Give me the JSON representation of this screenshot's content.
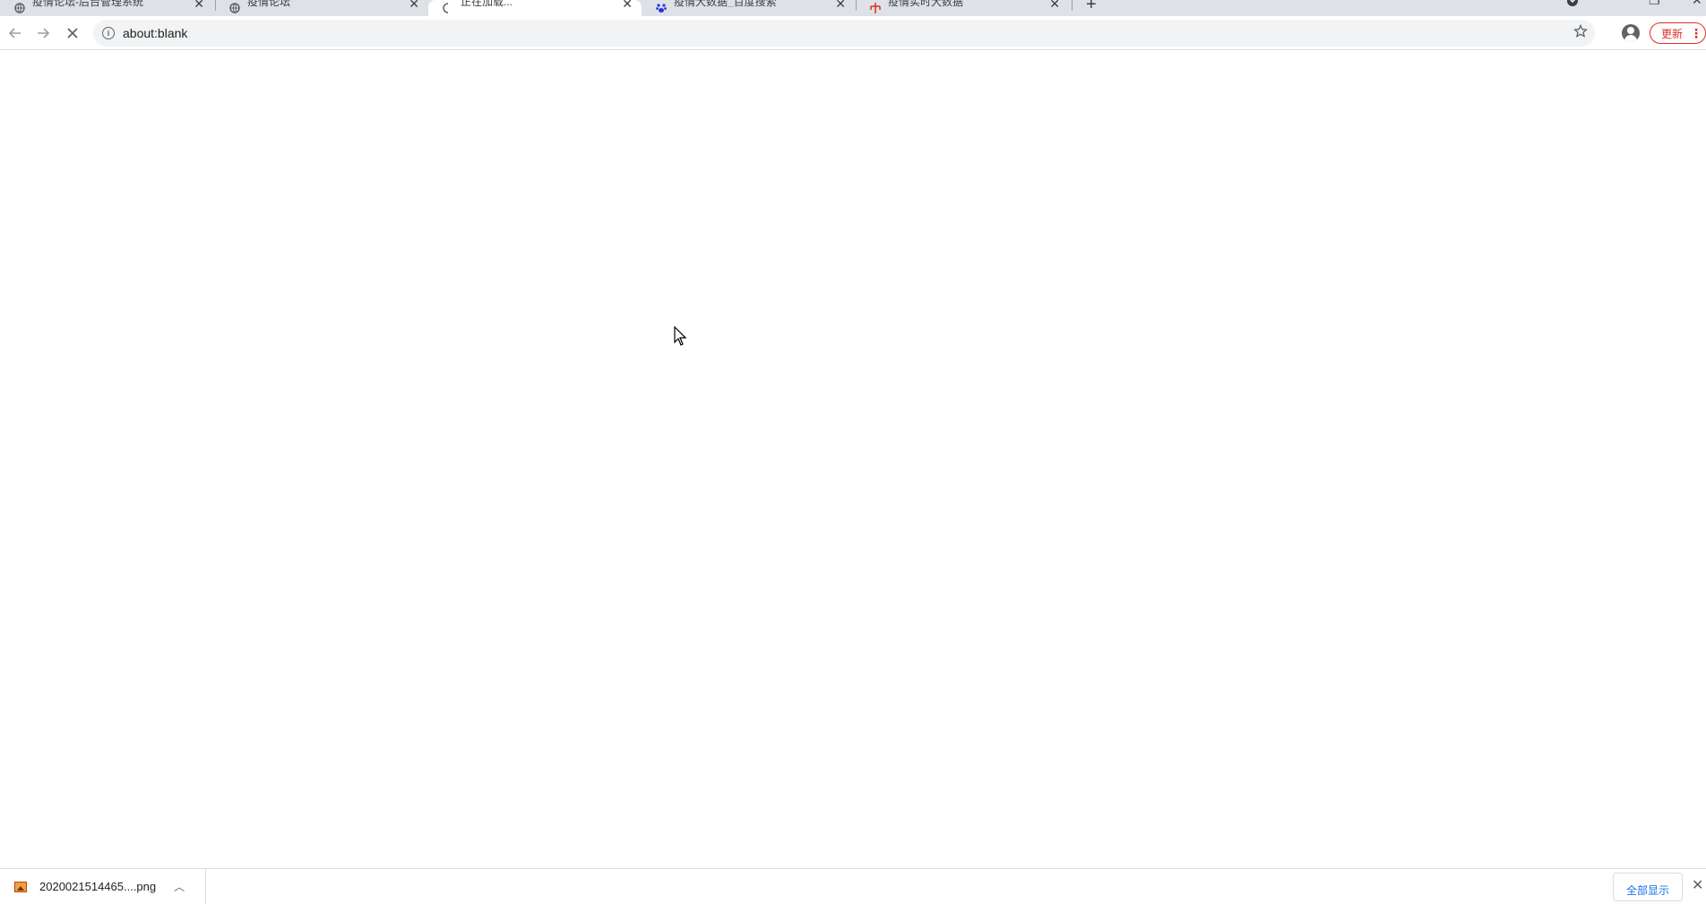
{
  "tabs": [
    {
      "title": "疫情论坛-后台管理系统",
      "favicon": "globe-icon",
      "active": false
    },
    {
      "title": "疫情论坛",
      "favicon": "globe-icon",
      "active": false
    },
    {
      "title": "正在加载...",
      "favicon": "loading-spinner-icon",
      "active": true
    },
    {
      "title": "疫情大数据_百度搜索",
      "favicon": "baidu-paw-icon",
      "active": false
    },
    {
      "title": "疫情实时大数据",
      "favicon": "red-logo-icon",
      "active": false
    }
  ],
  "toolbar": {
    "url": "about:blank",
    "update_label": "更新"
  },
  "downloads": {
    "filename": "2020021514465....png",
    "show_all_label": "全部显示"
  },
  "colors": {
    "update_accent": "#d93025",
    "link_blue": "#1a73e8"
  }
}
